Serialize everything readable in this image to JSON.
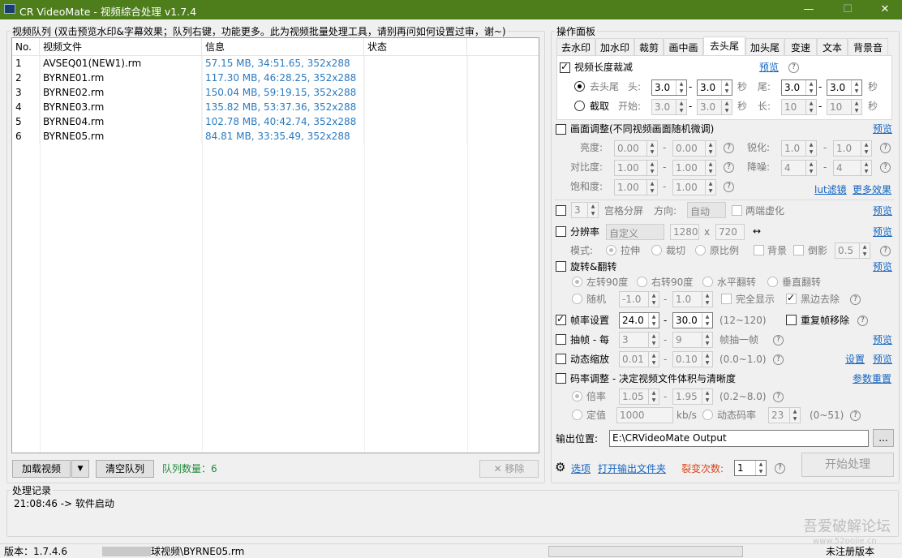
{
  "window": {
    "title": "CR VideoMate - 视频综合处理 v1.7.4",
    "min": "—",
    "max": "☐",
    "close": "✕"
  },
  "queue": {
    "legend": "视频队列 (双击预览水印&字幕效果；队列右键，功能更多。此为视频批量处理工具，请别再问如何设置过审，谢~)",
    "headers": [
      "No.",
      "视频文件",
      "信息",
      "状态"
    ],
    "rows": [
      {
        "no": "1",
        "file": "AVSEQ01(NEW1).rm",
        "info": "57.15 MB, 34:51.65, 352x288",
        "status": ""
      },
      {
        "no": "2",
        "file": "BYRNE01.rm",
        "info": "117.30 MB, 46:28.25, 352x288",
        "status": ""
      },
      {
        "no": "3",
        "file": "BYRNE02.rm",
        "info": "150.04 MB, 59:19.15, 352x288",
        "status": ""
      },
      {
        "no": "4",
        "file": "BYRNE03.rm",
        "info": "135.82 MB, 53:37.36, 352x288",
        "status": ""
      },
      {
        "no": "5",
        "file": "BYRNE04.rm",
        "info": "102.78 MB, 40:42.74, 352x288",
        "status": ""
      },
      {
        "no": "6",
        "file": "BYRNE05.rm",
        "info": "84.81 MB, 33:35.49, 352x288",
        "status": ""
      }
    ],
    "load_btn": "加载视频",
    "dropdown": "▼",
    "clear_btn": "清空队列",
    "count": "队列数量：6",
    "remove_btn": "✕ 移除"
  },
  "panel": {
    "legend": "操作面板",
    "tabs": [
      "去水印",
      "加水印",
      "裁剪",
      "画中画",
      "去头尾",
      "加头尾",
      "变速",
      "文本",
      "背景音"
    ],
    "trim": {
      "title": "视频长度裁减",
      "preview": "预览",
      "q": "?",
      "r1": "去头尾",
      "head": "头:",
      "h1": "3.0",
      "h2": "3.0",
      "sec": "秒",
      "tail": "尾:",
      "t1": "3.0",
      "t2": "3.0",
      "r2": "截取",
      "start": "开始:",
      "s1": "3.0",
      "s2": "3.0",
      "len": "长:",
      "l1": "10",
      "l2": "10",
      "dash": "-"
    },
    "adjust": {
      "title": "画面调整(不同视频画面随机微调)",
      "preview": "预览",
      "bright": "亮度:",
      "b1": "0.00",
      "b2": "0.00",
      "sharp": "锐化:",
      "sh1": "1.0",
      "sh2": "1.0",
      "contrast": "对比度:",
      "c1": "1.00",
      "c2": "1.00",
      "noise": "降噪:",
      "n1": "4",
      "n2": "4",
      "sat": "饱和度:",
      "sa1": "1.00",
      "sa2": "1.00",
      "lut": "lut滤镜",
      "more": "更多效果"
    },
    "grid": {
      "num": "3",
      "label": "宫格分屏",
      "dir": "方向:",
      "dirval": "自动",
      "blur": "两端虚化",
      "preview": "预览"
    },
    "res": {
      "title": "分辨率",
      "preset": "自定义",
      "w": "1280",
      "x": "x",
      "h": "720",
      "arrow": "↔",
      "preview": "预览",
      "mode": "模式:",
      "m1": "拉伸",
      "m2": "裁切",
      "m3": "原比例",
      "bg": "背景",
      "reflect": "倒影",
      "rv": "0.5"
    },
    "rotate": {
      "title": "旋转&翻转",
      "preview": "预览",
      "r1": "左转90度",
      "r2": "右转90度",
      "r3": "水平翻转",
      "r4": "垂直翻转",
      "rand": "随机",
      "a1": "-1.0",
      "a2": "1.0",
      "full": "完全显示",
      "black": "黑边去除"
    },
    "fps": {
      "title": "帧率设置",
      "f1": "24.0",
      "f2": "30.0",
      "range": "(12~120)",
      "dup": "重复帧移除"
    },
    "extract": {
      "title": "抽帧 - 每",
      "e1": "3",
      "e2": "9",
      "unit": "帧抽一帧",
      "preview": "预览"
    },
    "zoom": {
      "title": "动态缩放",
      "z1": "0.01",
      "z2": "0.10",
      "range": "(0.0~1.0)",
      "set": "设置",
      "preview": "预览"
    },
    "bitrate": {
      "title": "码率调整 - 决定视频文件体积与清晰度",
      "reset": "参数重置",
      "r1": "倍率",
      "k1": "1.05",
      "k2": "1.95",
      "range": "(0.2~8.0)",
      "r2": "定值",
      "fixed": "1000",
      "unit": "kb/s",
      "dyn": "动态码率",
      "dv": "23",
      "drange": "(0~51)"
    },
    "output": {
      "label": "输出位置:",
      "path": "E:\\CRVideoMate Output",
      "browse": "..."
    },
    "footer": {
      "options": "选项",
      "open": "打开输出文件夹",
      "split": "裂变次数:",
      "splitv": "1",
      "start": "开始处理"
    }
  },
  "log": {
    "legend": "处理记录",
    "line": "21:08:46 -> 软件启动"
  },
  "status": {
    "version": "版本：1.7.4.6",
    "file": "球视频\\BYRNE05.rm",
    "reg": "未注册版本",
    "watermark": "吾爱破解论坛",
    "wm2": "www.52pojie.cn"
  }
}
